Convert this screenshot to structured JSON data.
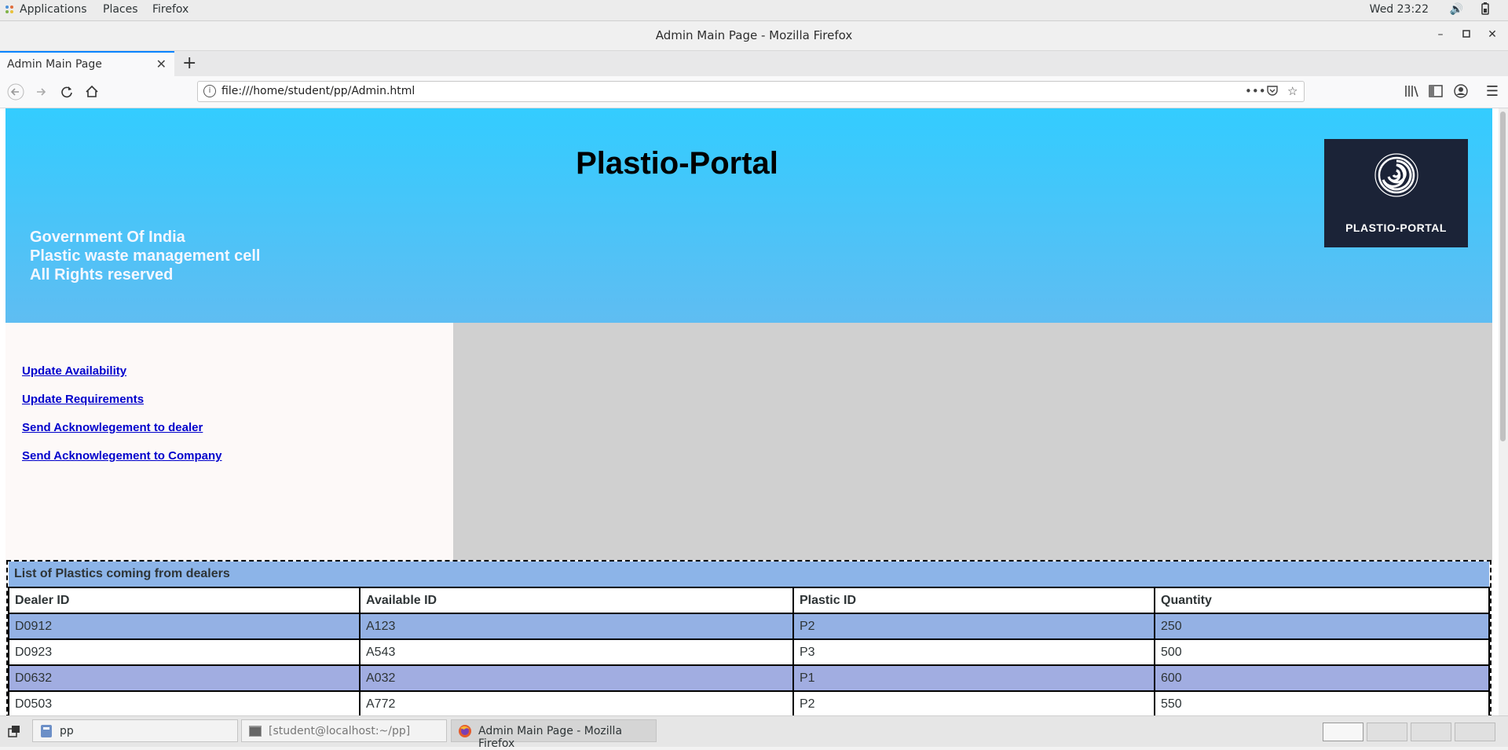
{
  "system_bar": {
    "menus": [
      "Applications",
      "Places",
      "Firefox"
    ],
    "clock": "Wed 23:22"
  },
  "window": {
    "title": "Admin Main Page - Mozilla Firefox"
  },
  "browser": {
    "tab_title": "Admin Main Page",
    "url": "file:///home/student/pp/Admin.html"
  },
  "page": {
    "heading": "Plastio-Portal",
    "info_lines": [
      "Government Of India",
      "Plastic waste management cell",
      "All Rights reserved"
    ],
    "logo_text": "PLASTIO-PORTAL",
    "nav_links": [
      "Update Availability",
      "Update Requirements",
      "Send Acknowlegement to dealer",
      "Send Acknowlegement to Company"
    ],
    "table": {
      "caption": "List of Plastics coming from dealers",
      "headers": [
        "Dealer ID",
        "Available ID",
        "Plastic ID",
        "Quantity"
      ],
      "rows": [
        [
          "D0912",
          "A123",
          "P2",
          "250"
        ],
        [
          "D0923",
          "A543",
          "P3",
          "500"
        ],
        [
          "D0632",
          "A032",
          "P1",
          "600"
        ],
        [
          "D0503",
          "A772",
          "P2",
          "550"
        ]
      ]
    }
  },
  "taskbar": {
    "items": [
      "pp",
      "[student@localhost:~/pp]",
      "Admin Main Page - Mozilla Firefox"
    ]
  },
  "colors": {
    "header_top": "#33ccff",
    "header_bottom": "#5fbdf2",
    "link": "#0000cc",
    "sidebar_bg": "#fdf9f8",
    "grey_panel": "#d0d0d0",
    "table_caption_bg": "#8cb4e8"
  }
}
